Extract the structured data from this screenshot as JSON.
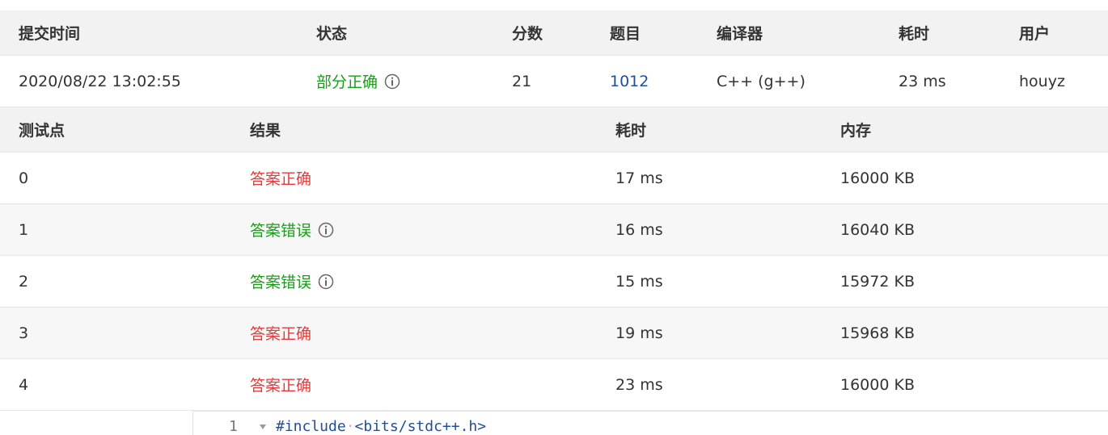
{
  "submission": {
    "headers": [
      "提交时间",
      "状态",
      "分数",
      "题目",
      "编译器",
      "耗时",
      "用户"
    ],
    "time": "2020/08/22 13:02:55",
    "status": "部分正确",
    "score": "21",
    "problem": "1012",
    "compiler": "C++ (g++)",
    "duration": "23 ms",
    "user": "houyz"
  },
  "cases": {
    "headers": [
      "测试点",
      "结果",
      "耗时",
      "内存"
    ],
    "rows": [
      {
        "id": "0",
        "result": "答案正确",
        "time": "17 ms",
        "memory": "16000 KB"
      },
      {
        "id": "1",
        "result": "答案错误",
        "time": "16 ms",
        "memory": "16040 KB"
      },
      {
        "id": "2",
        "result": "答案错误",
        "time": "15 ms",
        "memory": "15972 KB"
      },
      {
        "id": "3",
        "result": "答案正确",
        "time": "19 ms",
        "memory": "15968 KB"
      },
      {
        "id": "4",
        "result": "答案正确",
        "time": "23 ms",
        "memory": "16000 KB"
      }
    ]
  },
  "editor": {
    "line_number": "1",
    "code_directive": "#include",
    "code_header": "<bits/stdc++.h>"
  },
  "colors": {
    "partial": "#1a9e1a",
    "correct": "#e03c3c",
    "wrong": "#1a9e1a",
    "link": "#1f4f99"
  }
}
